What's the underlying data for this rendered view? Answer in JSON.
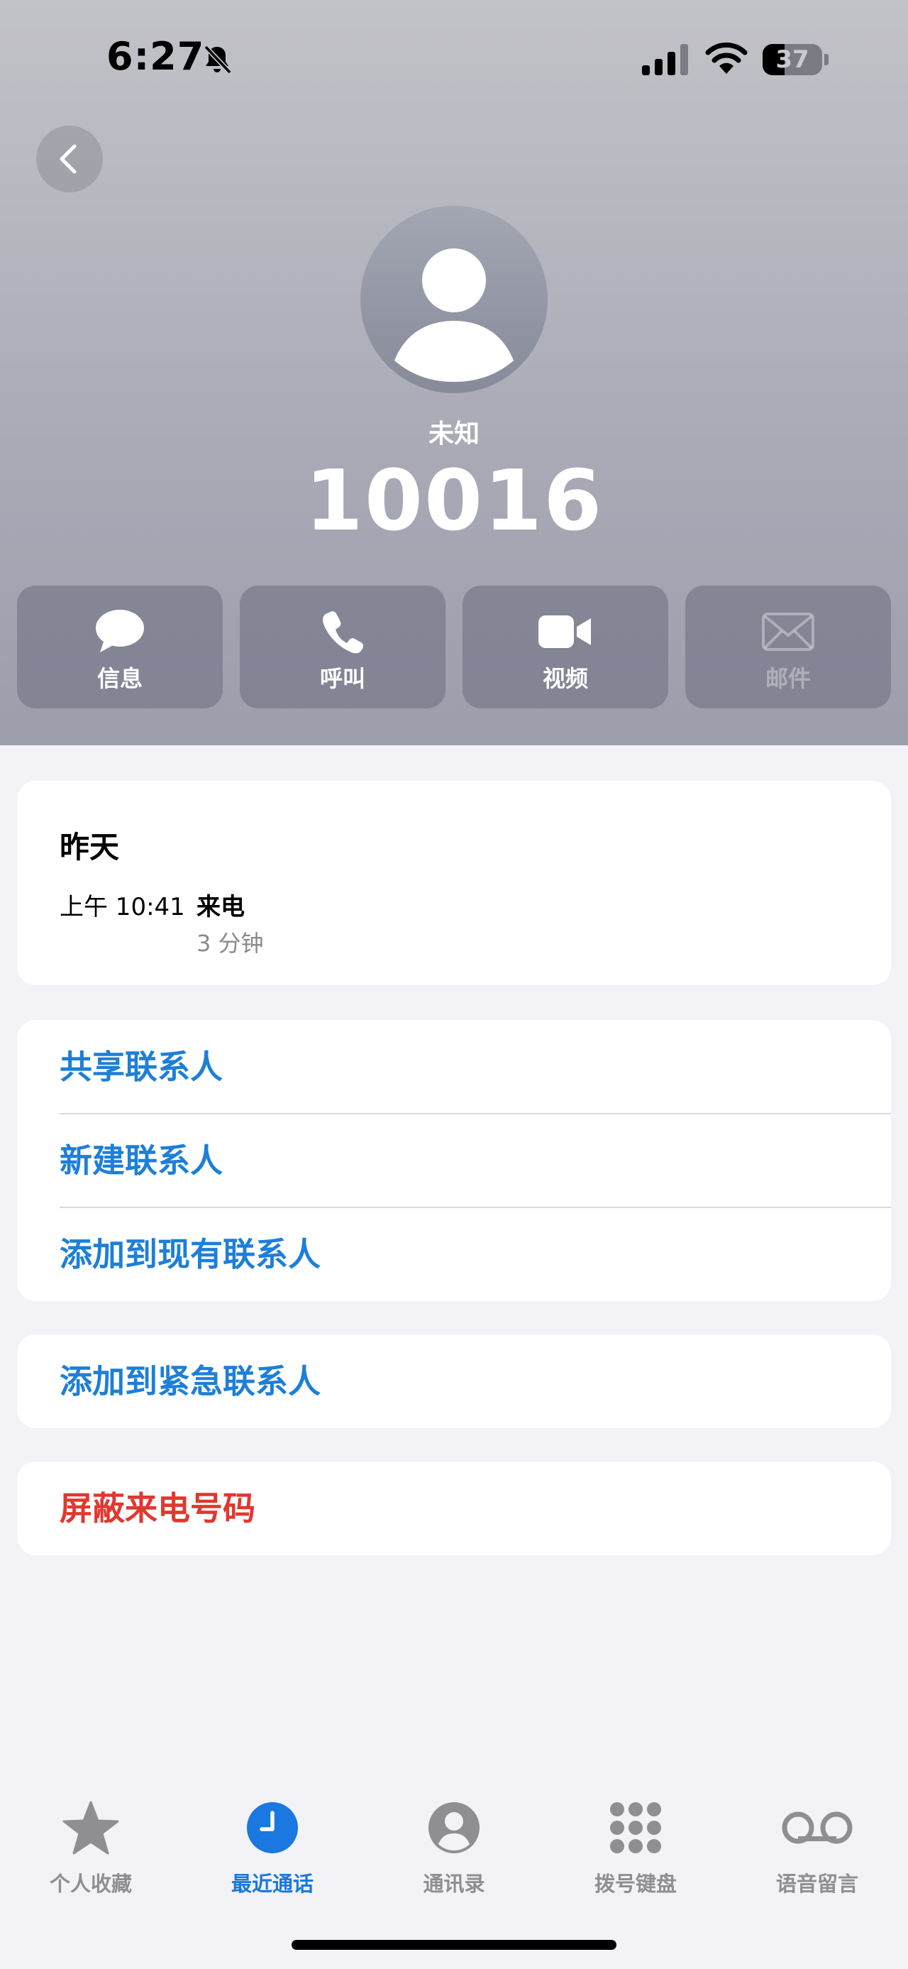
{
  "status_bar": {
    "time": "6:27",
    "battery": "37",
    "battery_level": 0.37
  },
  "contact": {
    "label": "未知",
    "number": "10016"
  },
  "actions": [
    {
      "label": "信息",
      "icon": "message-bubble-icon",
      "enabled": true
    },
    {
      "label": "呼叫",
      "icon": "phone-icon",
      "enabled": true
    },
    {
      "label": "视频",
      "icon": "video-camera-icon",
      "enabled": true
    },
    {
      "label": "邮件",
      "icon": "mail-envelope-icon",
      "enabled": false
    }
  ],
  "call_history": {
    "day": "昨天",
    "time": "上午 10:41",
    "type": "来电",
    "duration": "3 分钟"
  },
  "options": {
    "share_contact": "共享联系人",
    "new_contact": "新建联系人",
    "add_to_existing": "添加到现有联系人",
    "add_to_emergency": "添加到紧急联系人",
    "block_caller": "屏蔽来电号码"
  },
  "tabs": [
    {
      "label": "个人收藏",
      "icon": "star-icon",
      "active": false
    },
    {
      "label": "最近通话",
      "icon": "clock-icon",
      "active": true
    },
    {
      "label": "通讯录",
      "icon": "person-circle-icon",
      "active": false
    },
    {
      "label": "拨号键盘",
      "icon": "keypad-grid-icon",
      "active": false
    },
    {
      "label": "语音留言",
      "icon": "voicemail-icon",
      "active": false
    }
  ],
  "colors": {
    "link_blue": "#1d7fd8",
    "danger_red": "#e0382f",
    "tab_active": "#1a78e0",
    "tab_inactive": "#8e8e93",
    "page_background": "#f2f2f7"
  }
}
